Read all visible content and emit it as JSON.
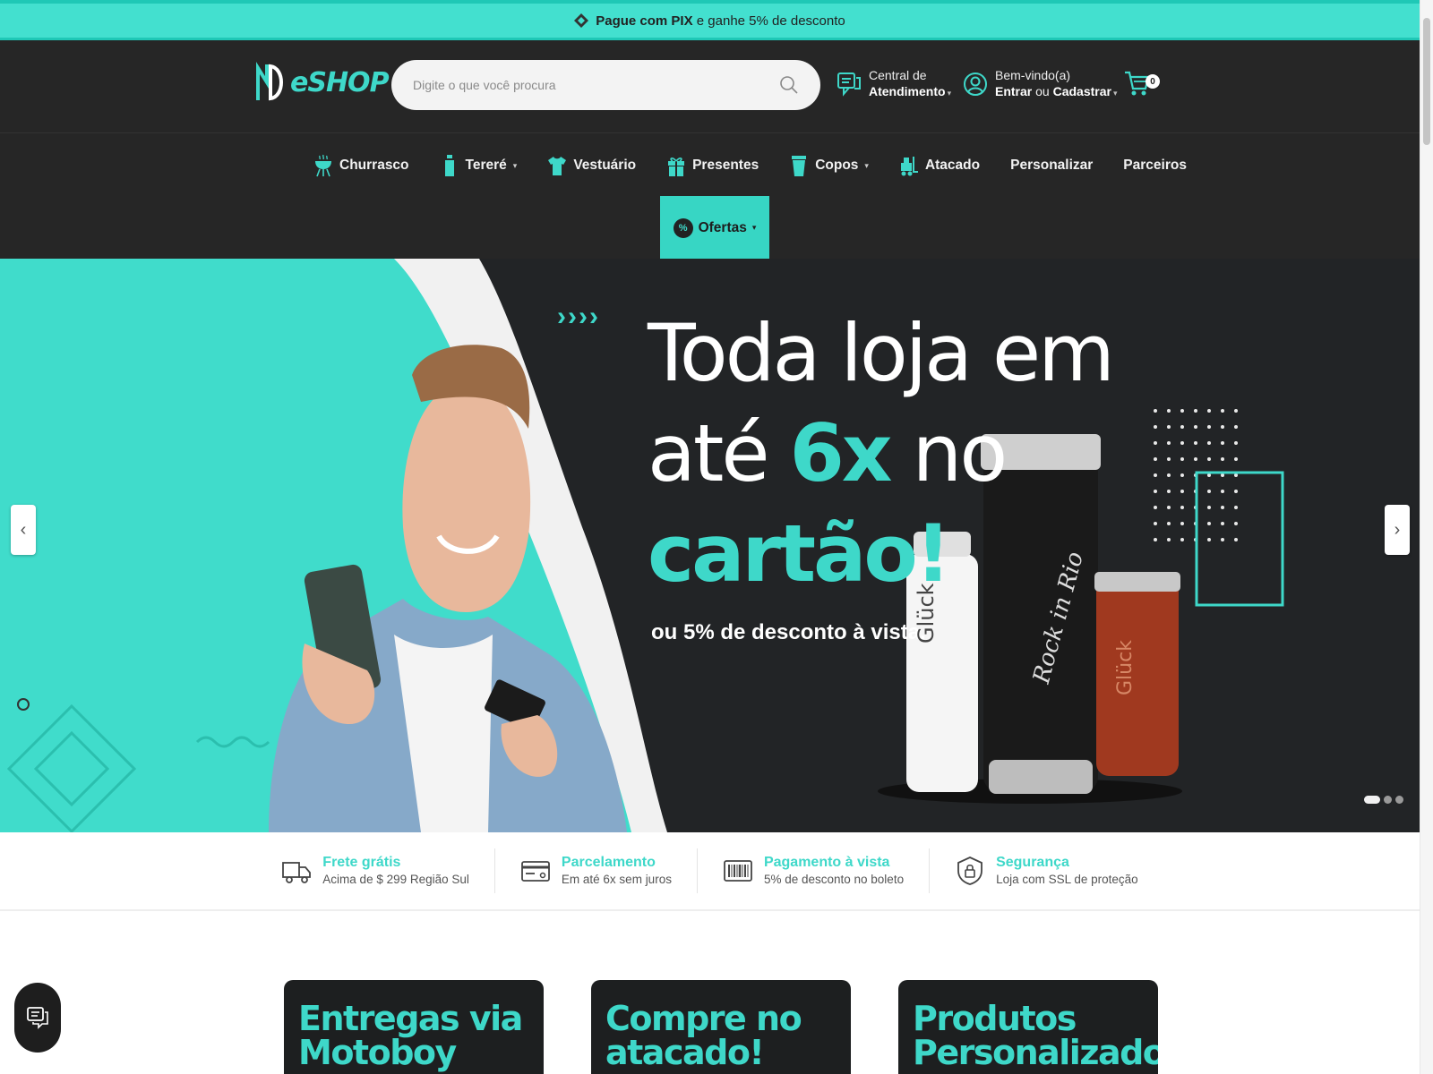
{
  "promo": {
    "strong": "Pague com PIX",
    "rest": "e ganhe 5% de desconto"
  },
  "header": {
    "logo_text": "eSHOP",
    "search_placeholder": "Digite o que você procura",
    "support": {
      "line1": "Central de",
      "line2": "Atendimento"
    },
    "account": {
      "line1": "Bem-vindo(a)",
      "line2_a": "Entrar",
      "line2_b": "ou",
      "line2_c": "Cadastrar"
    },
    "cart_count": "0"
  },
  "nav": {
    "items": [
      {
        "label": "Churrasco",
        "icon": "grill-icon"
      },
      {
        "label": "Tereré",
        "icon": "bottle-icon",
        "dropdown": true
      },
      {
        "label": "Vestuário",
        "icon": "tshirt-icon"
      },
      {
        "label": "Presentes",
        "icon": "gift-icon"
      },
      {
        "label": "Copos",
        "icon": "cup-icon",
        "dropdown": true
      },
      {
        "label": "Atacado",
        "icon": "forklift-icon"
      },
      {
        "label": "Personalizar"
      },
      {
        "label": "Parceiros"
      }
    ],
    "ofertas": {
      "label": "Ofertas",
      "badge": "%"
    }
  },
  "banner": {
    "line1": "Toda loja em",
    "line2_a": "até",
    "line2_b": "6x",
    "line2_c": "no",
    "line3": "cartão!",
    "subline": "ou 5% de desconto à vista.",
    "arrows": "››››",
    "cup_brand": "Glück",
    "cup_brand_center": "Rock in Rio"
  },
  "features": [
    {
      "title": "Frete grátis",
      "subtitle": "Acima de $ 299 Região Sul",
      "icon": "truck-icon"
    },
    {
      "title": "Parcelamento",
      "subtitle": "Em até 6x sem juros",
      "icon": "credit-card-icon"
    },
    {
      "title": "Pagamento à vista",
      "subtitle": "5% de desconto no boleto",
      "icon": "barcode-icon"
    },
    {
      "title": "Segurança",
      "subtitle": "Loja com SSL de proteção",
      "icon": "shield-lock-icon"
    }
  ],
  "cards": [
    {
      "line1": "Entregas via",
      "line2": "Motoboy"
    },
    {
      "line1": "Compre no",
      "line2": "atacado!"
    },
    {
      "line1": "Produtos",
      "line2": "Personalizados"
    }
  ],
  "colors": {
    "accent": "#3ed8c9",
    "dark": "#262626",
    "promo": "#43e0cf"
  }
}
